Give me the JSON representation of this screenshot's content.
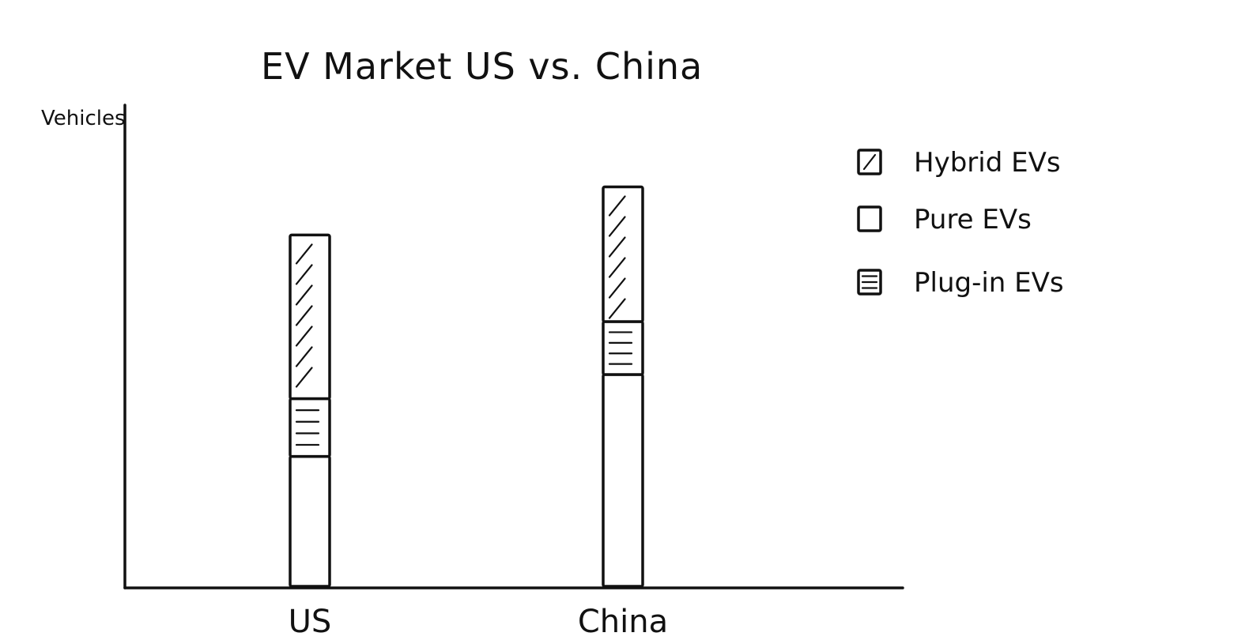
{
  "chart_data": {
    "type": "bar",
    "stacked": true,
    "title": "EV Market US vs. China",
    "ylabel": "Vehicles",
    "xlabel": "",
    "categories": [
      "US",
      "China"
    ],
    "series": [
      {
        "name": "Pure EVs",
        "pattern": "blank",
        "values": [
          27,
          44
        ]
      },
      {
        "name": "Plug-in EVs",
        "pattern": "horizontal-lines",
        "values": [
          12,
          11
        ]
      },
      {
        "name": "Hybrid EVs",
        "pattern": "diagonal-lines",
        "values": [
          34,
          28
        ]
      }
    ],
    "legend_order": [
      "Hybrid EVs",
      "Pure EVs",
      "Plug-in EVs"
    ],
    "ylim": [
      0,
      100
    ],
    "grid": false,
    "legend_position": "top-right",
    "color": "#111111"
  }
}
